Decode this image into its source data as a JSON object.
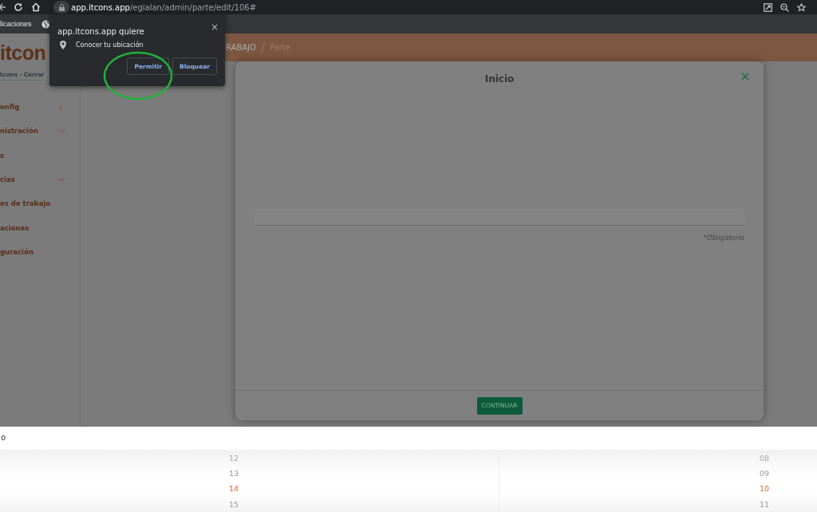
{
  "browser": {
    "url_domain": "app.itcons.app",
    "url_path": "/egialan/admin/parte/edit/106#",
    "bookmark": "licaciones"
  },
  "permission_popup": {
    "title": "app.itcons.app quiere",
    "request": "Conocer tu ubicación",
    "close": "×",
    "buttons": [
      "Permitir",
      "Bloquear"
    ]
  },
  "sidebar": {
    "logo": "itcon",
    "user_line": "tcons - Cerrar",
    "items": [
      {
        "label": "onfig",
        "kind": "group",
        "expanded": false
      },
      {
        "label": "nistración",
        "kind": "group",
        "expanded": true
      },
      {
        "label": "s",
        "kind": "link"
      },
      {
        "label": "cias",
        "kind": "group",
        "expanded": true
      },
      {
        "label": "es de trabajo",
        "kind": "link"
      },
      {
        "label": "aciones",
        "kind": "link"
      },
      {
        "label": "guración",
        "kind": "link"
      }
    ]
  },
  "breadcrumb": [
    "RABAJO",
    "Parte"
  ],
  "modal": {
    "title": "Inicio",
    "note": "*Obligatorio",
    "button": "CONTINUAR"
  },
  "below": {
    "label": "o"
  },
  "picker": {
    "columns": [
      {
        "items": [
          {
            "text": "12",
            "selected": false
          },
          {
            "text": "13",
            "selected": false
          },
          {
            "text": "14",
            "selected": true
          },
          {
            "text": "15",
            "selected": false
          }
        ]
      },
      {
        "items": [
          {
            "text": "08",
            "selected": false
          },
          {
            "text": "09",
            "selected": false
          },
          {
            "text": "10",
            "selected": true
          },
          {
            "text": "11",
            "selected": false
          }
        ]
      }
    ]
  }
}
